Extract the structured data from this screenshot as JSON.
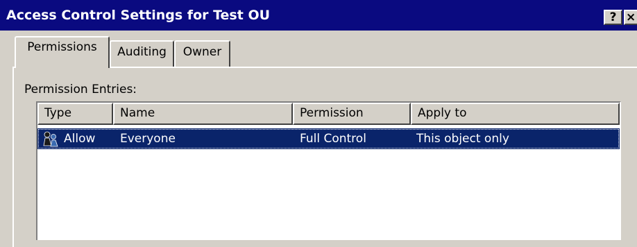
{
  "window": {
    "title": "Access Control Settings for Test OU",
    "help_button": "?",
    "close_button": "×"
  },
  "tabs": [
    {
      "label": "Permissions",
      "selected": true
    },
    {
      "label": "Auditing",
      "selected": false
    },
    {
      "label": "Owner",
      "selected": false
    }
  ],
  "permissions": {
    "entries_label": "Permission Entries:",
    "columns": [
      "Type",
      "Name",
      "Permission",
      "Apply to"
    ],
    "rows": [
      {
        "icon": "user-group-icon",
        "type": "Allow",
        "name": "Everyone",
        "permission": "Full Control",
        "apply_to": "This object only",
        "selected": true
      }
    ]
  },
  "colors": {
    "title_bar": "#0a0a80",
    "selection": "#0a246a",
    "face": "#d4d0c8"
  }
}
